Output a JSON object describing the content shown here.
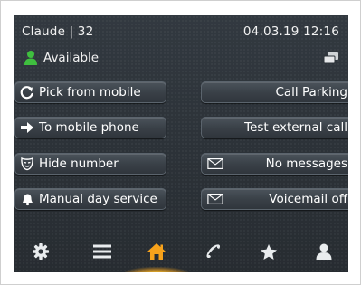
{
  "header": {
    "user": "Claude | 32",
    "datetime": "04.03.19  12:16"
  },
  "status": {
    "presence": "Available",
    "presence_color": "#3fbf3f",
    "presence_icon": "user-available-icon",
    "screens_icon": "screens-icon"
  },
  "left_buttons": [
    {
      "label": "Pick from mobile",
      "icon": "pick-up-icon"
    },
    {
      "label": "To mobile phone",
      "icon": "arrow-right-icon"
    },
    {
      "label": "Hide number",
      "icon": "mask-icon"
    },
    {
      "label": "Manual day service",
      "icon": "bell-icon"
    }
  ],
  "right_buttons": [
    {
      "label": "Call Parking",
      "icon": ""
    },
    {
      "label": "Test external call",
      "icon": ""
    },
    {
      "label": "No messages",
      "icon": "envelope-icon"
    },
    {
      "label": "Voicemail off",
      "icon": "envelope-icon"
    }
  ],
  "nav": {
    "items": [
      "settings-icon",
      "menu-icon",
      "home-icon",
      "phone-icon",
      "star-icon",
      "contacts-icon"
    ],
    "active": "home-icon",
    "active_color": "#f7a21b"
  }
}
